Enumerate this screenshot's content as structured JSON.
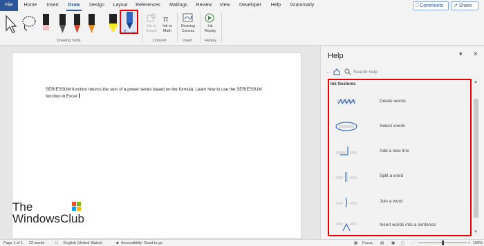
{
  "menu": {
    "tabs": [
      "File",
      "Home",
      "Insert",
      "Draw",
      "Design",
      "Layout",
      "References",
      "Mailings",
      "Review",
      "View",
      "Developer",
      "Help",
      "Grammarly"
    ],
    "active": "Draw",
    "comments_label": "Comments",
    "share_label": "Share"
  },
  "ribbon": {
    "groups": {
      "drawing_tools": "Drawing Tools",
      "convert": "Convert",
      "insert": "Insert",
      "replay": "Replay"
    },
    "buttons": {
      "ink_to_shape": "Ink to Shape",
      "ink_to_math": "Ink to Math",
      "drawing_canvas": "Drawing Canvas",
      "ink_replay": "Ink Replay"
    }
  },
  "document": {
    "text": "SERIESSUM function returns the sum of a power series based on the formula. Learn how to use the SERIESSUM function in Excel."
  },
  "watermark": {
    "line1": "The",
    "line2": "WindowsClub"
  },
  "help": {
    "title": "Help",
    "search_placeholder": "Search help",
    "section_title": "Ink Gestures",
    "gestures": [
      "Delete words",
      "Select words",
      "Add a new line",
      "Split a word",
      "Join a word",
      "Insert words into a sentence"
    ]
  },
  "status": {
    "page": "Page 1 of 1",
    "words": "22 words",
    "language": "English (United States)",
    "accessibility": "Accessibility: Good to go",
    "focus": "Focus",
    "zoom": "100%"
  },
  "colors": {
    "accent": "#2b579a",
    "highlight": "#e00000",
    "gesture": "#3a6fc4"
  }
}
